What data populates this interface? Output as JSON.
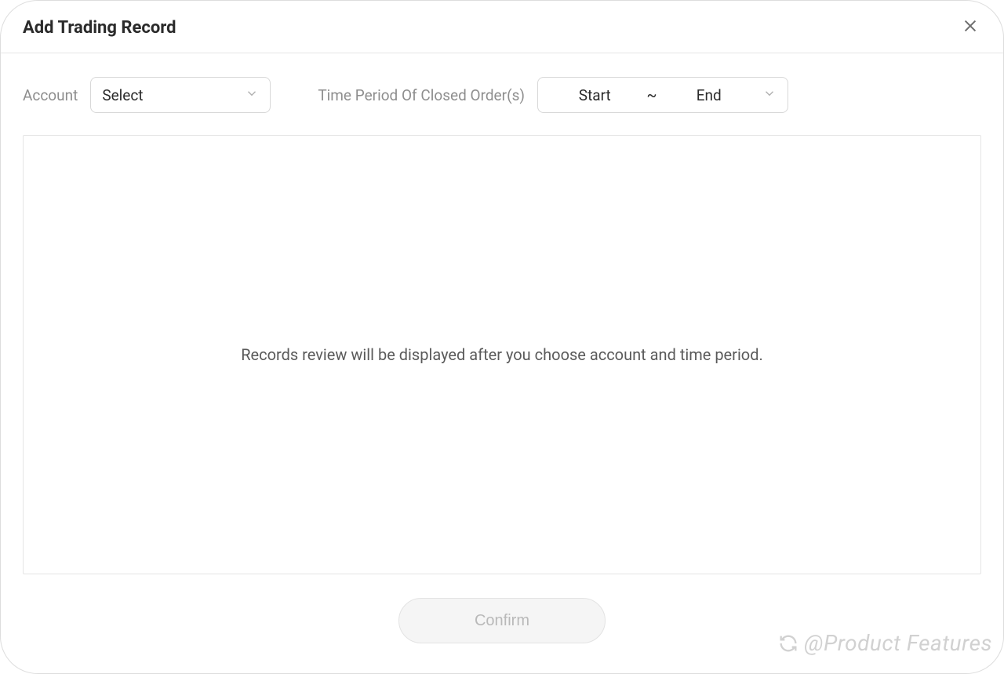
{
  "modal": {
    "title": "Add Trading Record"
  },
  "filters": {
    "account_label": "Account",
    "account_select_placeholder": "Select",
    "time_period_label": "Time Period Of Closed Order(s)",
    "start_placeholder": "Start",
    "range_separator": "~",
    "end_placeholder": "End"
  },
  "content": {
    "placeholder": "Records review will be displayed after you choose account and time period."
  },
  "footer": {
    "confirm_label": "Confirm"
  },
  "watermark": {
    "text": "@Product Features"
  }
}
